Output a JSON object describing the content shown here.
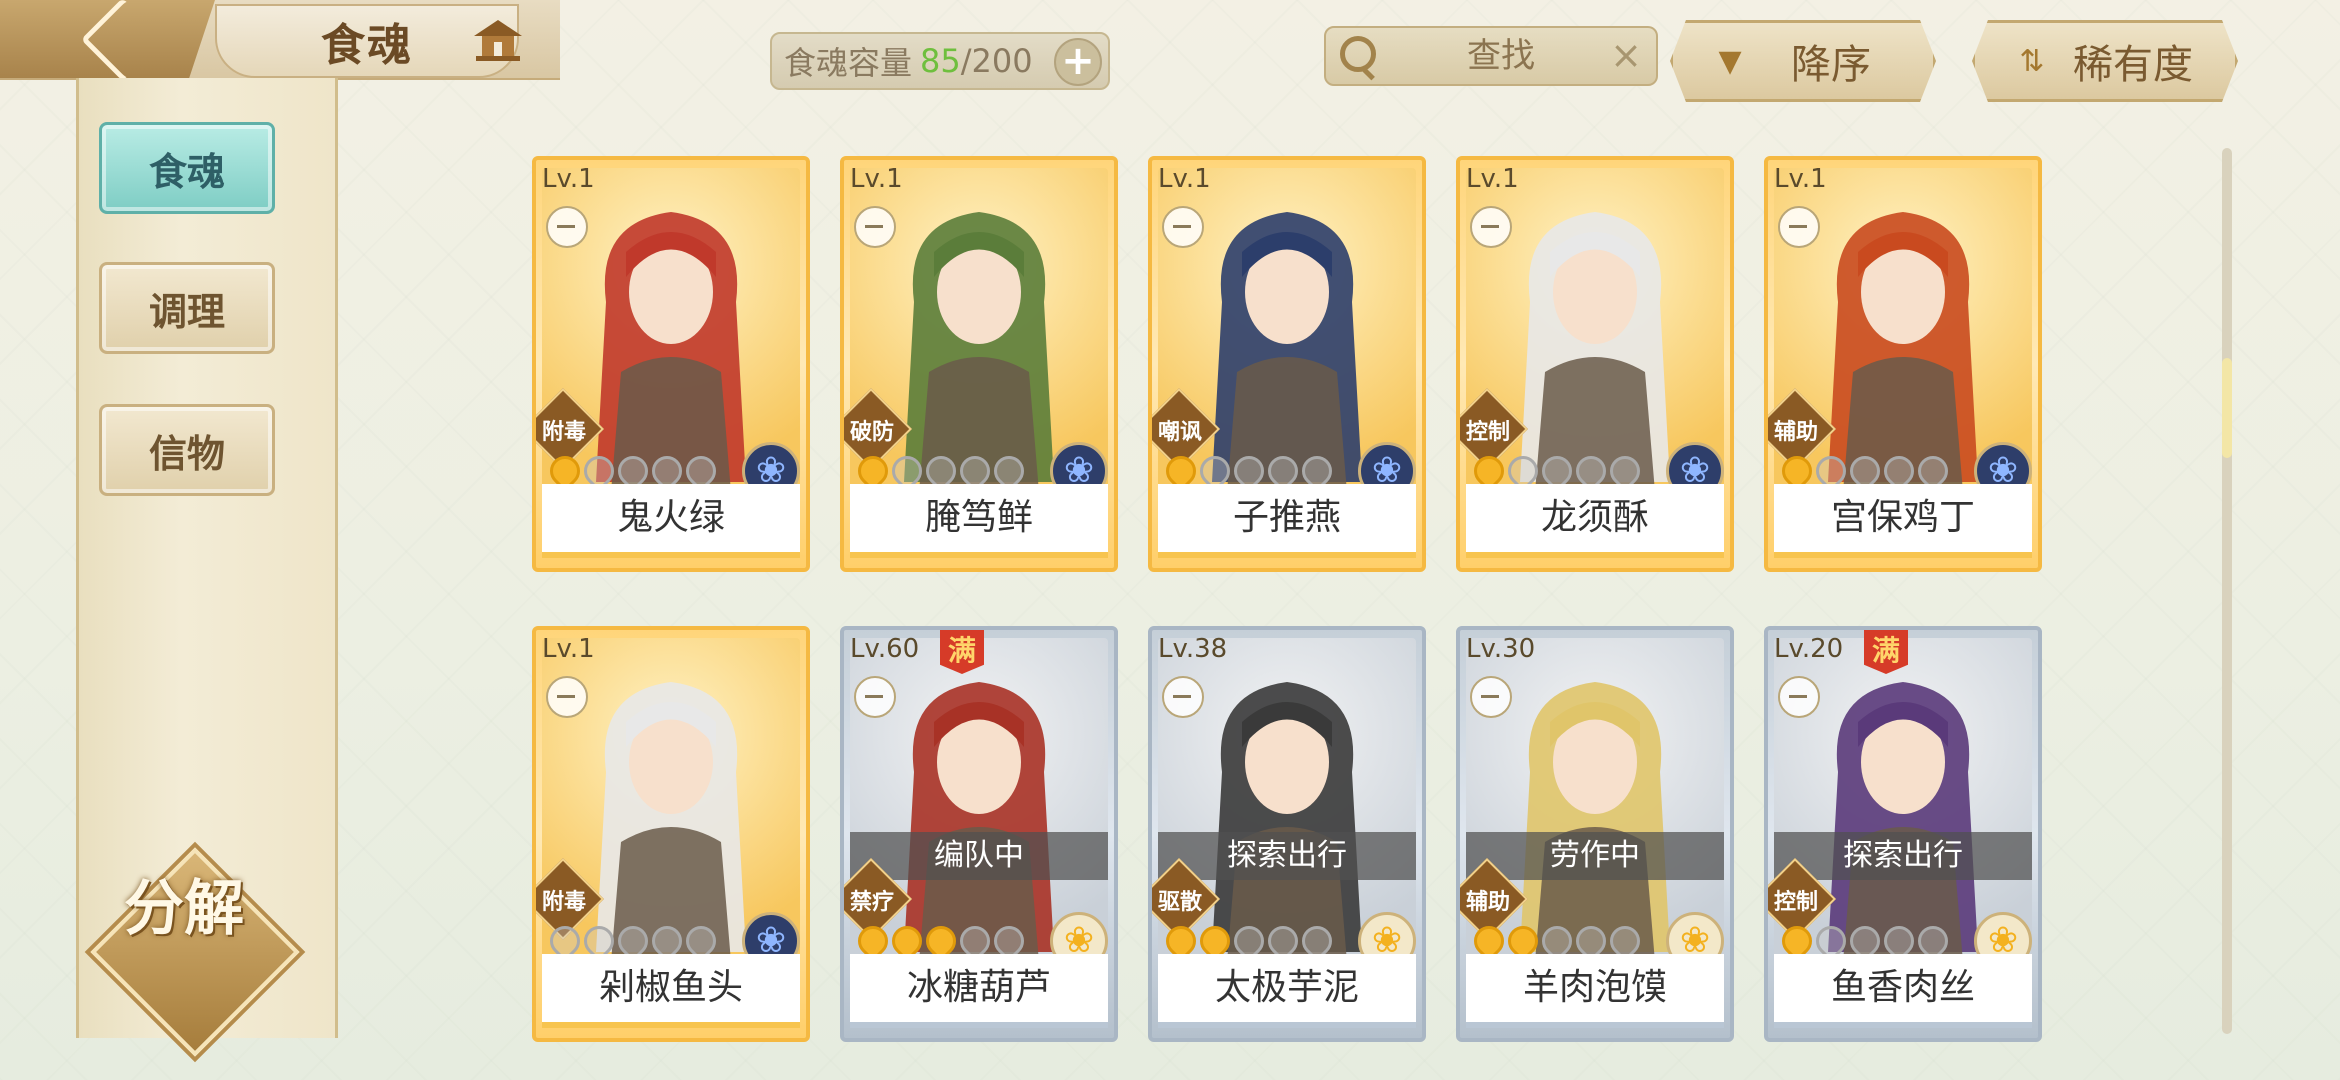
{
  "header": {
    "title": "食魂"
  },
  "sidebar": {
    "items": [
      {
        "label": "食魂",
        "active": true
      },
      {
        "label": "调理",
        "active": false
      },
      {
        "label": "信物",
        "active": false
      }
    ],
    "decompose_label": "分解"
  },
  "capacity": {
    "label": "食魂容量",
    "current": "85",
    "max": "/200",
    "add": "+"
  },
  "search": {
    "placeholder": "查找",
    "clear": "×"
  },
  "sort": {
    "order_label": "降序",
    "order_icon": "▼",
    "filter_label": "稀有度",
    "filter_icon": "⇅"
  },
  "colors": {
    "accent_teal": "#7ecdc4",
    "gold_frame": "#f5b942",
    "silver_frame": "#a9b6c4",
    "capacity_current": "#6fbf3e"
  },
  "cards": [
    {
      "level": "Lv.1",
      "role": "附毒",
      "name": "鬼火绿",
      "frame": "gold",
      "stars": 1,
      "status": "",
      "max": "",
      "flower": "blue"
    },
    {
      "level": "Lv.1",
      "role": "破防",
      "name": "腌笃鲜",
      "frame": "gold",
      "stars": 1,
      "status": "",
      "max": "",
      "flower": "blue"
    },
    {
      "level": "Lv.1",
      "role": "嘲讽",
      "name": "子推燕",
      "frame": "gold",
      "stars": 1,
      "status": "",
      "max": "",
      "flower": "blue"
    },
    {
      "level": "Lv.1",
      "role": "控制",
      "name": "龙须酥",
      "frame": "gold",
      "stars": 1,
      "status": "",
      "max": "",
      "flower": "blue"
    },
    {
      "level": "Lv.1",
      "role": "辅助",
      "name": "宫保鸡丁",
      "frame": "gold",
      "stars": 1,
      "status": "",
      "max": "",
      "flower": "blue"
    },
    {
      "level": "Lv.1",
      "role": "附毒",
      "name": "剁椒鱼头",
      "frame": "gold",
      "stars": 0,
      "status": "",
      "max": "",
      "flower": "blue"
    },
    {
      "level": "Lv.60",
      "role": "禁疗",
      "name": "冰糖葫芦",
      "frame": "silver",
      "stars": 3,
      "status": "编队中",
      "max": "满",
      "flower": "yellow"
    },
    {
      "level": "Lv.38",
      "role": "驱散",
      "name": "太极芋泥",
      "frame": "silver",
      "stars": 2,
      "status": "探索出行",
      "max": "",
      "flower": "yellow"
    },
    {
      "level": "Lv.30",
      "role": "辅助",
      "name": "羊肉泡馍",
      "frame": "silver",
      "stars": 2,
      "status": "劳作中",
      "max": "",
      "flower": "yellow"
    },
    {
      "level": "Lv.20",
      "role": "控制",
      "name": "鱼香肉丝",
      "frame": "silver",
      "stars": 1,
      "status": "探索出行",
      "max": "满",
      "flower": "yellow"
    }
  ]
}
